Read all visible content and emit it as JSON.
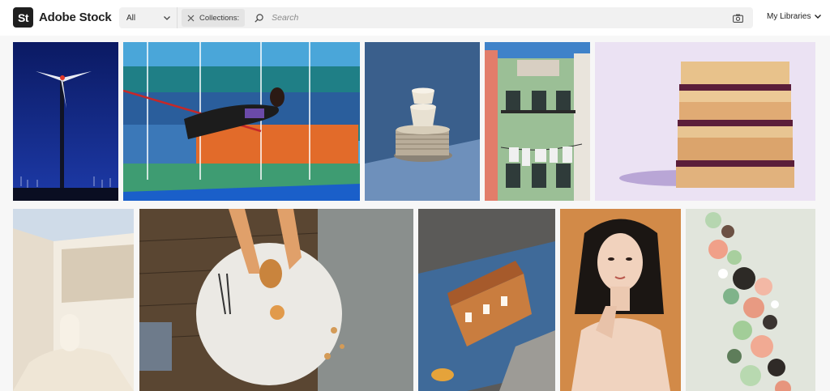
{
  "header": {
    "logo_mark": "St",
    "logo_text": "Adobe Stock",
    "filter": {
      "selected": "All"
    },
    "collections_tag": "Collections:",
    "search": {
      "placeholder": "Search",
      "value": ""
    },
    "libraries_label": "My Libraries"
  },
  "gallery": {
    "images": [
      {
        "subject": "wind-turbine-night"
      },
      {
        "subject": "high-jump-athlete-stadium"
      },
      {
        "subject": "stacked-teacups-saucers"
      },
      {
        "subject": "building-facade-laundry-balcony"
      },
      {
        "subject": "peanut-butter-jelly-sandwich-stack"
      },
      {
        "subject": "white-architecture-stairwell"
      },
      {
        "subject": "cafe-table-croissant-overhead"
      },
      {
        "subject": "puddle-building-reflection"
      },
      {
        "subject": "woman-portrait-orange-backdrop"
      },
      {
        "subject": "abstract-spheres-column"
      }
    ]
  },
  "colors": {
    "brand_dark": "#1f1f1f",
    "search_bg": "#f1f1f1",
    "gallery_bg": "#f7f7f7"
  }
}
